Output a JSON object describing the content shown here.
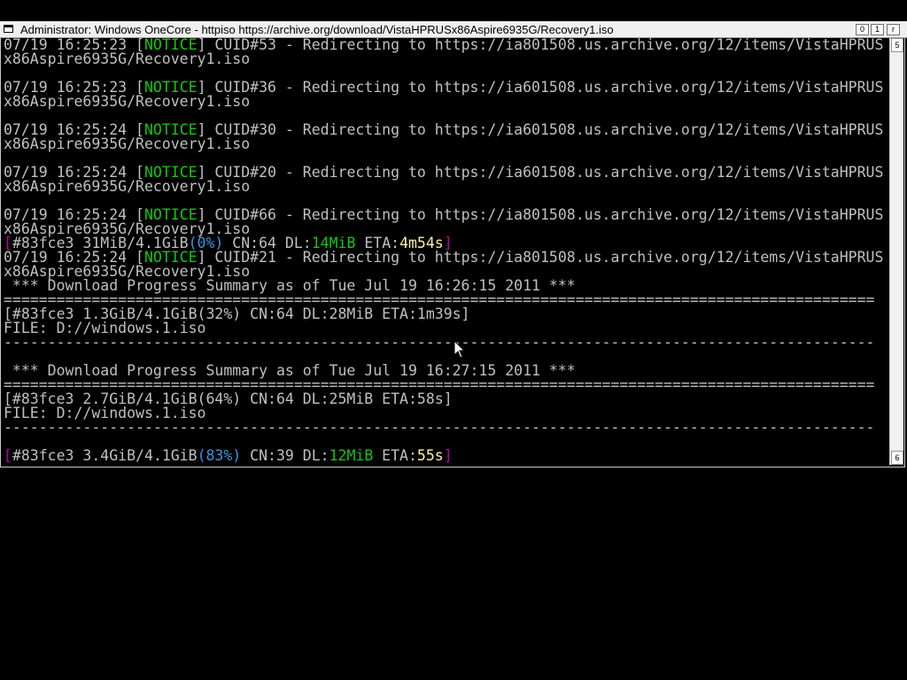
{
  "window": {
    "title": "Administrator:  Windows OneCore - httpiso  https://archive.org/download/VistaHPRUSx86Aspire6935G/Recovery1.iso",
    "btn_min": "0",
    "btn_max": "1",
    "btn_close": "r",
    "scroll_up": "5",
    "scroll_down": "6"
  },
  "lines": [
    [
      {
        "t": "07/19 16:25:23 ["
      },
      {
        "t": "NOTICE",
        "c": "g"
      },
      {
        "t": "] CUID#53 - Redirecting to https://ia801508.us.archive.org/12/items/VistaHPRUS"
      }
    ],
    [
      {
        "t": "x86Aspire6935G/Recovery1.iso"
      }
    ],
    [
      {
        "t": ""
      }
    ],
    [
      {
        "t": "07/19 16:25:23 ["
      },
      {
        "t": "NOTICE",
        "c": "g"
      },
      {
        "t": "] CUID#36 - Redirecting to https://ia601508.us.archive.org/12/items/VistaHPRUS"
      }
    ],
    [
      {
        "t": "x86Aspire6935G/Recovery1.iso"
      }
    ],
    [
      {
        "t": ""
      }
    ],
    [
      {
        "t": "07/19 16:25:24 ["
      },
      {
        "t": "NOTICE",
        "c": "g"
      },
      {
        "t": "] CUID#30 - Redirecting to https://ia601508.us.archive.org/12/items/VistaHPRUS"
      }
    ],
    [
      {
        "t": "x86Aspire6935G/Recovery1.iso"
      }
    ],
    [
      {
        "t": ""
      }
    ],
    [
      {
        "t": "07/19 16:25:24 ["
      },
      {
        "t": "NOTICE",
        "c": "g"
      },
      {
        "t": "] CUID#20 - Redirecting to https://ia601508.us.archive.org/12/items/VistaHPRUS"
      }
    ],
    [
      {
        "t": "x86Aspire6935G/Recovery1.iso"
      }
    ],
    [
      {
        "t": ""
      }
    ],
    [
      {
        "t": "07/19 16:25:24 ["
      },
      {
        "t": "NOTICE",
        "c": "g"
      },
      {
        "t": "] CUID#66 - Redirecting to https://ia801508.us.archive.org/12/items/VistaHPRUS"
      }
    ],
    [
      {
        "t": "x86Aspire6935G/Recovery1.iso"
      }
    ],
    [
      {
        "t": "[",
        "c": "m"
      },
      {
        "t": "#83fce3 31MiB/4.1GiB"
      },
      {
        "t": "(0%)",
        "c": "c"
      },
      {
        "t": " CN:64 DL:"
      },
      {
        "t": "14MiB",
        "c": "g"
      },
      {
        "t": " ETA:"
      },
      {
        "t": "4m54s",
        "c": "y"
      },
      {
        "t": "]",
        "c": "m"
      }
    ],
    [
      {
        "t": "07/19 16:25:24 ["
      },
      {
        "t": "NOTICE",
        "c": "g"
      },
      {
        "t": "] CUID#21 - Redirecting to https://ia801508.us.archive.org/12/items/VistaHPRUS"
      }
    ],
    [
      {
        "t": "x86Aspire6935G/Recovery1.iso"
      }
    ],
    [
      {
        "t": " *** Download Progress Summary as of Tue Jul 19 16:26:15 2011 ***"
      }
    ],
    [
      {
        "t": "==================================================================================================="
      }
    ],
    [
      {
        "t": "[#83fce3 1.3GiB/4.1GiB(32%) CN:64 DL:28MiB ETA:1m39s]"
      }
    ],
    [
      {
        "t": "FILE: D://windows.1.iso"
      }
    ],
    [
      {
        "t": "---------------------------------------------------------------------------------------------------"
      }
    ],
    [
      {
        "t": ""
      }
    ],
    [
      {
        "t": " *** Download Progress Summary as of Tue Jul 19 16:27:15 2011 ***"
      }
    ],
    [
      {
        "t": "==================================================================================================="
      }
    ],
    [
      {
        "t": "[#83fce3 2.7GiB/4.1GiB(64%) CN:64 DL:25MiB ETA:58s]"
      }
    ],
    [
      {
        "t": "FILE: D://windows.1.iso"
      }
    ],
    [
      {
        "t": "---------------------------------------------------------------------------------------------------"
      }
    ],
    [
      {
        "t": ""
      }
    ],
    [
      {
        "t": "[",
        "c": "m"
      },
      {
        "t": "#83fce3 3.4GiB/4.1GiB"
      },
      {
        "t": "(83%)",
        "c": "c"
      },
      {
        "t": " CN:39 DL:"
      },
      {
        "t": "12MiB",
        "c": "g"
      },
      {
        "t": " ETA:"
      },
      {
        "t": "55s",
        "c": "y"
      },
      {
        "t": "]",
        "c": "m"
      }
    ]
  ],
  "colors": {
    "terminal_bg": "#000000",
    "terminal_fg": "#c0c0c0",
    "notice": "#16c60c",
    "bracket": "#b4009e",
    "percent": "#3a96dd",
    "eta": "#f9f1a5"
  },
  "icons": [
    "console-window-icon",
    "mouse-pointer-icon"
  ]
}
